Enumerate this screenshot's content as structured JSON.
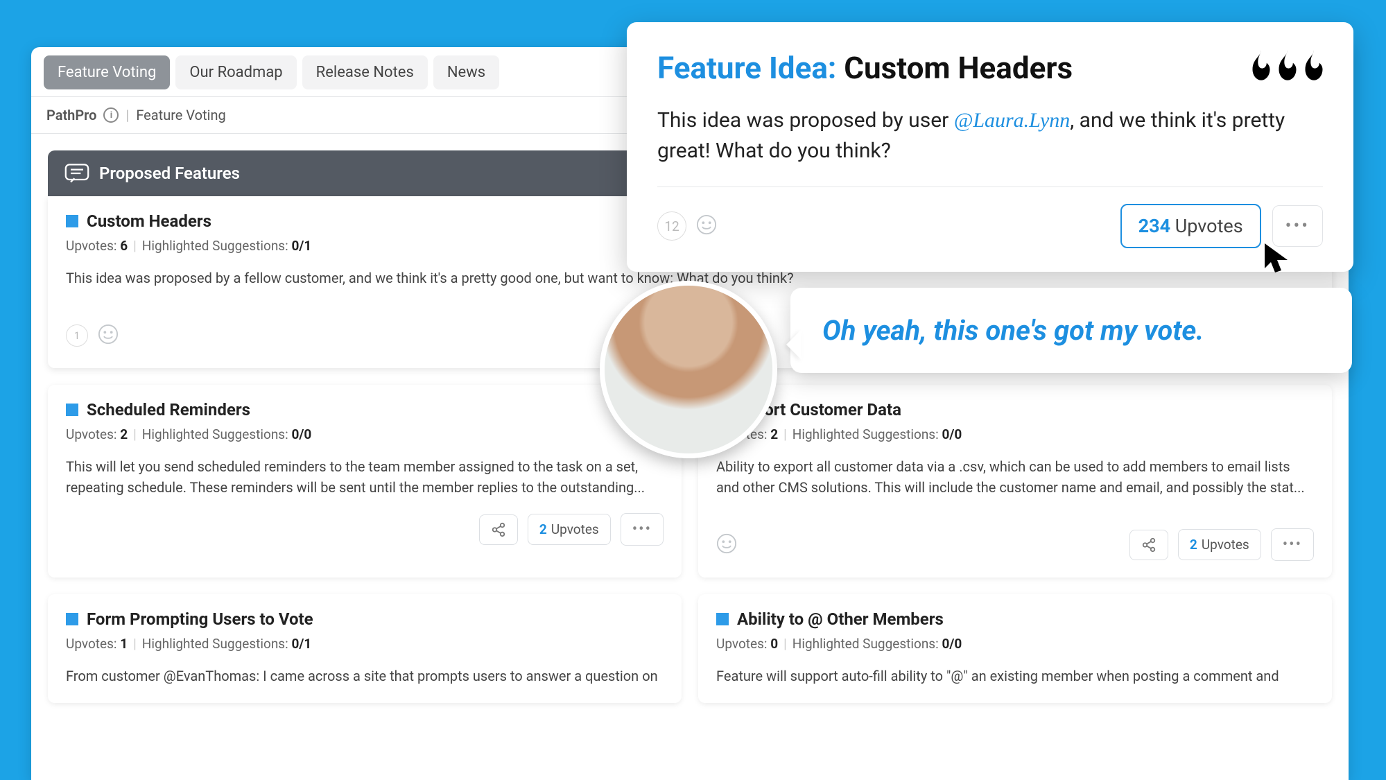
{
  "tabs": [
    "Feature Voting",
    "Our Roadmap",
    "Release Notes",
    "News"
  ],
  "active_tab": 0,
  "breadcrumb": {
    "brand": "PathPro",
    "page": "Feature Voting"
  },
  "section_title": "Proposed Features",
  "cards": [
    {
      "title": "Custom Headers",
      "upvotes": "6",
      "upvotes_label": "Upvotes:",
      "suggestions_label": "Highlighted Suggestions:",
      "suggestions": "0/1",
      "desc": "This idea was proposed by a fellow customer, and we think it's a pretty good one, but want to know: What do you think?",
      "comment_count": "1",
      "upvote_btn_num": "234",
      "upvote_btn_text": "Upvotes",
      "hot": false
    },
    {
      "title": "Scheduled Reminders",
      "upvotes": "2",
      "upvotes_label": "Upvotes:",
      "suggestions_label": "Highlighted Suggestions:",
      "suggestions": "0/0",
      "desc": "This will let you send scheduled reminders to the team member assigned to the task on a set, repeating schedule. These reminders will be sent until the member replies to the outstanding...",
      "upvote_btn_num": "2",
      "upvote_btn_text": "Upvotes",
      "hot": true
    },
    {
      "title": "Export Customer Data",
      "upvotes": "2",
      "upvotes_label": "Upvotes:",
      "suggestions_label": "Highlighted Suggestions:",
      "suggestions": "0/0",
      "desc": "Ability to export all customer data via a .csv, which can be used to add members to email lists and other CMS solutions. This will include the customer name and email, and possibly the stat...",
      "upvote_btn_num": "2",
      "upvote_btn_text": "Upvotes",
      "hot": false
    },
    {
      "title": "Form Prompting Users to Vote",
      "upvotes": "1",
      "upvotes_label": "Upvotes:",
      "suggestions_label": "Highlighted Suggestions:",
      "suggestions": "0/1",
      "desc": "From customer @EvanThomas: I came across a site that prompts users to answer a question on",
      "hot": false
    },
    {
      "title": "Ability to @ Other Members",
      "upvotes": "0",
      "upvotes_label": "Upvotes:",
      "suggestions_label": "Highlighted Suggestions:",
      "suggestions": "0/0",
      "desc": "Feature will support auto-fill ability to \"@\" an existing member when posting a comment and",
      "hot": false
    }
  ],
  "overlay": {
    "lead": "Feature Idea:",
    "title": "Custom Headers",
    "body_pre": "This idea was proposed by user ",
    "user": "@Laura.Lynn",
    "body_post": ", and we think it's pretty great! What do you think?",
    "comment_count": "12",
    "upvote_num": "234",
    "upvote_text": "Upvotes"
  },
  "bubble_text": "Oh yeah, this one's got my vote.",
  "flame": "🔥"
}
